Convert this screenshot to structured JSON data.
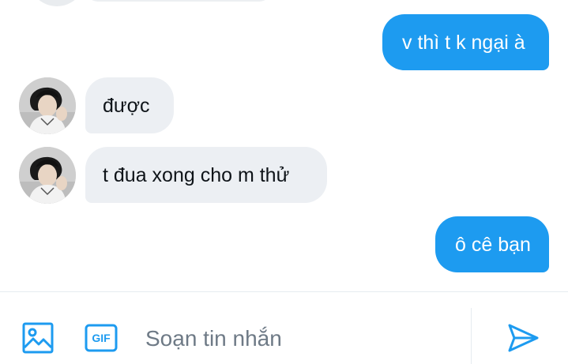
{
  "messages": [
    {
      "direction": "outgoing",
      "text": "v thì t k ngại à"
    },
    {
      "direction": "incoming",
      "text": "được"
    },
    {
      "direction": "incoming",
      "text": "t đua xong cho m thử"
    },
    {
      "direction": "outgoing",
      "text": "ô cê bạn"
    }
  ],
  "composer": {
    "placeholder": "Soạn tin nhắn",
    "gif_label": "GIF",
    "image_icon": "image-icon",
    "send_icon": "send-icon"
  },
  "colors": {
    "accent": "#1d9bf0",
    "incoming_bubble": "#eceff3"
  }
}
